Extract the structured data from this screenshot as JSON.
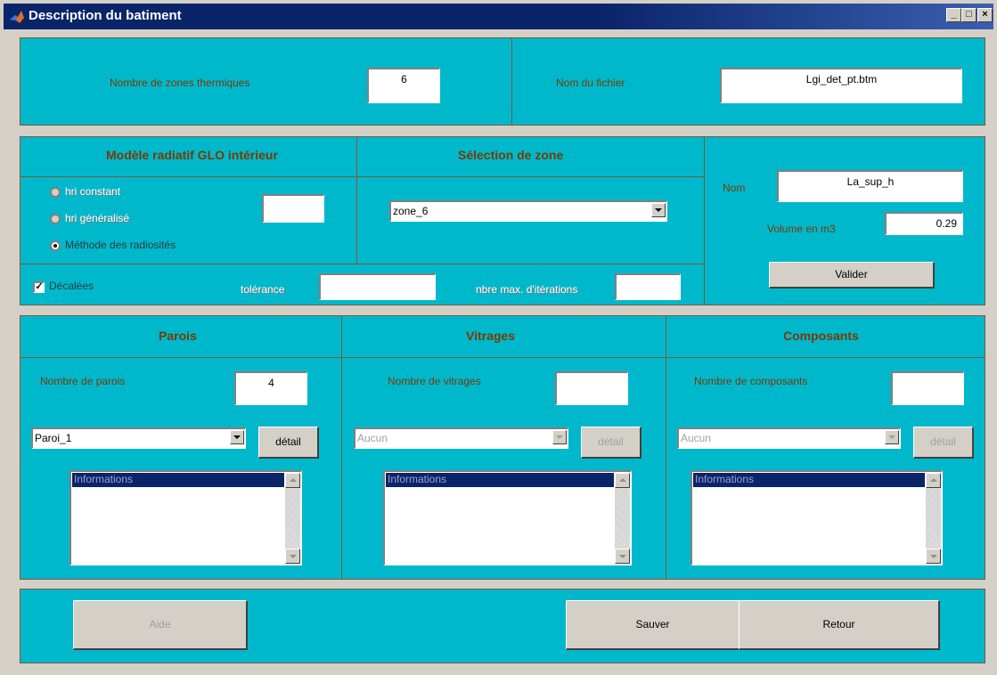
{
  "window": {
    "title": "Description du batiment"
  },
  "top": {
    "zones_label": "Nombre de zones thermiques",
    "zones_value": "6",
    "file_label": "Nom du fichier",
    "file_value": "Lgi_det_pt.btm"
  },
  "radiative": {
    "title": "Modèle radiatif GLO intérieur",
    "options": [
      "hri constant",
      "hri généralisé",
      "Méthode des radiosités"
    ],
    "selected": "Méthode des radiosités",
    "hri_value": "",
    "offset_label": "Décalées",
    "offset_checked": true,
    "tolerance_label": "tolérance",
    "tolerance_value": "",
    "maxiter_label": "nbre max. d'itérations",
    "maxiter_value": ""
  },
  "zone_selection": {
    "title": "Sélection de zone",
    "selected": "zone_6"
  },
  "zone": {
    "name_label": "Nom",
    "name_value": "La_sup_h",
    "volume_label": "Volume en m3",
    "volume_value": "0.29",
    "validate_label": "Valider"
  },
  "walls": {
    "title": "Parois",
    "count_label": "Nombre de parois",
    "count_value": "4",
    "selected": "Paroi_1",
    "detail_label": "détail",
    "info_label": "Informations"
  },
  "glazing": {
    "title": "Vitrages",
    "count_label": "Nombre de vitrages",
    "count_value": "",
    "selected": "Aucun",
    "detail_label": "détail",
    "info_label": "Informations"
  },
  "components": {
    "title": "Composants",
    "count_label": "Nombre de composants",
    "count_value": "",
    "selected": "Aucun",
    "detail_label": "détail",
    "info_label": "Informations"
  },
  "footer": {
    "help_label": "Aide",
    "save_label": "Sauver",
    "back_label": "Retour"
  }
}
